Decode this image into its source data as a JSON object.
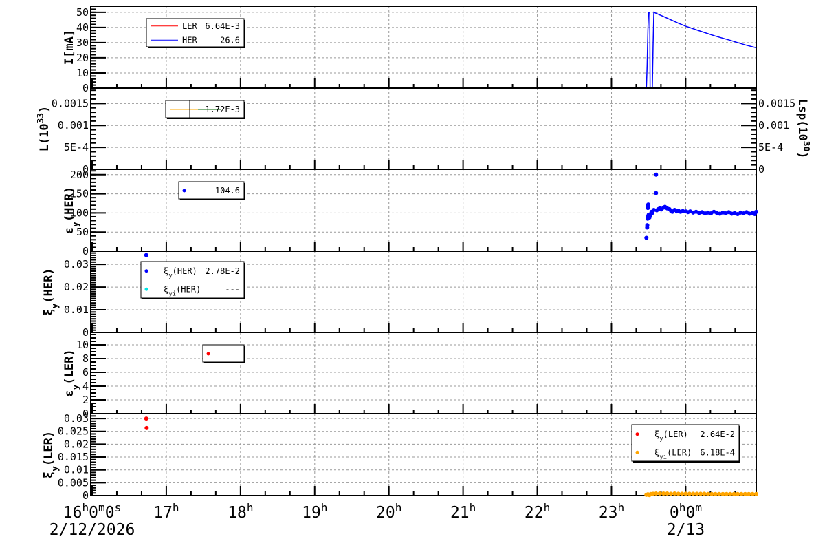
{
  "chart_data": [
    {
      "type": "line",
      "panel": "current",
      "ylabel": {
        "main": "I[mA]"
      },
      "ylim": [
        0,
        54
      ],
      "yticks": [
        {
          "v": 0,
          "t": "0"
        },
        {
          "v": 10,
          "t": "10"
        },
        {
          "v": 20,
          "t": "20"
        },
        {
          "v": 30,
          "t": "30"
        },
        {
          "v": 40,
          "t": "40"
        },
        {
          "v": 50,
          "t": "50"
        }
      ],
      "yminor_step": 2,
      "series": [
        {
          "name": "HER",
          "color": "#0000ff",
          "points": [
            [
              16,
              0
            ],
            [
              23.47,
              0
            ],
            [
              23.48,
              15
            ],
            [
              23.49,
              38
            ],
            [
              23.5,
              50
            ],
            [
              23.515,
              50
            ],
            [
              23.52,
              0
            ],
            [
              23.55,
              0
            ],
            [
              23.56,
              28
            ],
            [
              23.57,
              50
            ],
            [
              23.6,
              49.3
            ],
            [
              23.7,
              47.2
            ],
            [
              23.8,
              45
            ],
            [
              23.9,
              42.8
            ],
            [
              24,
              40.8
            ],
            [
              24.2,
              37.5
            ],
            [
              24.4,
              34.3
            ],
            [
              24.6,
              31.5
            ],
            [
              24.8,
              28.5
            ],
            [
              24.95,
              26.6
            ]
          ]
        },
        {
          "name": "LER",
          "color": "#ff0000",
          "points": [
            [
              23.3,
              0
            ],
            [
              24.95,
              0
            ]
          ]
        }
      ],
      "legend": [
        {
          "label": "LER",
          "value": "6.64E-3",
          "color": "#ff0000",
          "marker": "line"
        },
        {
          "label": "HER",
          "value": "26.6",
          "color": "#0000ff",
          "marker": "line"
        }
      ]
    },
    {
      "type": "line",
      "panel": "luminosity",
      "ylabel": {
        "main": "L(10",
        "sup": "33",
        "end": ")"
      },
      "ylabel_right": {
        "main": "Lsp(10",
        "sup": "30",
        "end": ")"
      },
      "ylim": [
        0,
        0.00185
      ],
      "yticks": [
        {
          "v": 0,
          "t": "0"
        },
        {
          "v": 0.0005,
          "t": "5E-4"
        },
        {
          "v": 0.001,
          "t": "0.001"
        },
        {
          "v": 0.0015,
          "t": "0.0015"
        }
      ],
      "yminor_step": 0.0001,
      "series": [],
      "legend": [
        {
          "label": "",
          "value": "1.72E-3",
          "color": "#ffaa00",
          "color2": "#006600",
          "marker": "line2"
        }
      ]
    },
    {
      "type": "scatter",
      "panel": "emittance-her",
      "ylabel": {
        "main": "ε",
        "sub": "y",
        "end": "(HER)"
      },
      "ylim": [
        0,
        214
      ],
      "yticks": [
        {
          "v": 0,
          "t": "0"
        },
        {
          "v": 50,
          "t": "50"
        },
        {
          "v": 100,
          "t": "100"
        },
        {
          "v": 150,
          "t": "150"
        },
        {
          "v": 200,
          "t": "200"
        }
      ],
      "yminor_step": 10,
      "series": [
        {
          "name": "εy(HER)",
          "color": "#0000ff",
          "points": [
            [
              23.47,
              35
            ],
            [
              23.48,
              62
            ],
            [
              23.482,
              68
            ],
            [
              23.487,
              85
            ],
            [
              23.49,
              90
            ],
            [
              23.49,
              113
            ],
            [
              23.492,
              118
            ],
            [
              23.495,
              122
            ],
            [
              23.5,
              95
            ],
            [
              23.51,
              88
            ],
            [
              23.52,
              92
            ],
            [
              23.53,
              98
            ],
            [
              23.54,
              103
            ],
            [
              23.55,
              100
            ],
            [
              23.57,
              108
            ],
            [
              23.6,
              200
            ],
            [
              23.6,
              152
            ],
            [
              23.61,
              107
            ],
            [
              23.63,
              110
            ],
            [
              23.65,
              112
            ],
            [
              23.67,
              109
            ],
            [
              23.7,
              114
            ],
            [
              23.72,
              116
            ],
            [
              23.75,
              112
            ],
            [
              23.78,
              110
            ],
            [
              23.8,
              106
            ],
            [
              23.82,
              103
            ],
            [
              23.85,
              108
            ],
            [
              23.88,
              104
            ],
            [
              23.9,
              106
            ],
            [
              23.93,
              103
            ],
            [
              23.96,
              105
            ],
            [
              24,
              104
            ],
            [
              24.03,
              102
            ],
            [
              24.06,
              104
            ],
            [
              24.1,
              101
            ],
            [
              24.14,
              103
            ],
            [
              24.18,
              100
            ],
            [
              24.22,
              102
            ],
            [
              24.26,
              99
            ],
            [
              24.3,
              101
            ],
            [
              24.34,
              99
            ],
            [
              24.38,
              103
            ],
            [
              24.42,
              100
            ],
            [
              24.46,
              98
            ],
            [
              24.5,
              101
            ],
            [
              24.54,
              99
            ],
            [
              24.58,
              102
            ],
            [
              24.62,
              98
            ],
            [
              24.66,
              100
            ],
            [
              24.7,
              97
            ],
            [
              24.74,
              101
            ],
            [
              24.78,
              99
            ],
            [
              24.82,
              102
            ],
            [
              24.86,
              98
            ],
            [
              24.9,
              100
            ],
            [
              24.93,
              97
            ],
            [
              24.95,
              103
            ]
          ]
        }
      ],
      "legend": [
        {
          "label": "",
          "value": "104.6",
          "color": "#0000ff",
          "marker": "dot"
        }
      ]
    },
    {
      "type": "scatter",
      "panel": "tuneshift-her",
      "ylabel": {
        "main": "ξ",
        "sub": "y",
        "end": "(HER)"
      },
      "ylim": [
        0,
        0.0358
      ],
      "yticks": [
        {
          "v": 0,
          "t": "0"
        },
        {
          "v": 0.01,
          "t": "0.01"
        },
        {
          "v": 0.02,
          "t": "0.02"
        },
        {
          "v": 0.03,
          "t": "0.03"
        }
      ],
      "yminor_step": 0.001,
      "series": [
        {
          "name": "ξy(HER)",
          "color": "#0000ff",
          "points": [
            [
              16.73,
              0.0341
            ],
            [
              16.73,
              0.028
            ],
            [
              16.735,
              0.0273
            ]
          ]
        },
        {
          "name": "ξyi(HER)",
          "color": "#00e5e5",
          "points": []
        }
      ],
      "legend": [
        {
          "label": {
            "main": "ξ",
            "sub": "y",
            "end": "(HER)"
          },
          "value": "2.78E-2",
          "color": "#0000ff",
          "marker": "dot"
        },
        {
          "label": {
            "main": "ξ",
            "sub": "yi",
            "end": "(HER)"
          },
          "value": "---",
          "color": "#00e5e5",
          "marker": "dot"
        }
      ]
    },
    {
      "type": "scatter",
      "panel": "emittance-ler",
      "ylabel": {
        "main": "ε",
        "sub": "y",
        "end": "(LER)"
      },
      "ylim": [
        0,
        11.8
      ],
      "yticks": [
        {
          "v": 0,
          "t": "0"
        },
        {
          "v": 2,
          "t": "2"
        },
        {
          "v": 4,
          "t": "4"
        },
        {
          "v": 6,
          "t": "6"
        },
        {
          "v": 8,
          "t": "8"
        },
        {
          "v": 10,
          "t": "10"
        }
      ],
      "yminor_step": 0.5,
      "series": [
        {
          "name": "εy(LER)",
          "color": "#ff0000",
          "points": []
        }
      ],
      "legend": [
        {
          "label": "",
          "value": "---",
          "color": "#ff0000",
          "marker": "dot"
        }
      ]
    },
    {
      "type": "scatter",
      "panel": "tuneshift-ler",
      "ylabel": {
        "main": "ξ",
        "sub": "y",
        "end": "(LER)"
      },
      "ylim": [
        0,
        0.0319
      ],
      "yticks": [
        {
          "v": 0,
          "t": "0"
        },
        {
          "v": 0.005,
          "t": "0.005"
        },
        {
          "v": 0.01,
          "t": "0.01"
        },
        {
          "v": 0.015,
          "t": "0.015"
        },
        {
          "v": 0.02,
          "t": "0.02"
        },
        {
          "v": 0.025,
          "t": "0.025"
        },
        {
          "v": 0.03,
          "t": "0.03"
        }
      ],
      "yminor_step": 0.001,
      "series": [
        {
          "name": "ξy(LER)",
          "color": "#ff0000",
          "points": [
            [
              16.73,
              0.03
            ],
            [
              16.735,
              0.0263
            ]
          ]
        },
        {
          "name": "ξyi(LER)",
          "color": "#ffa500",
          "points": [
            [
              23.47,
              0.0003
            ],
            [
              23.49,
              0.0005
            ],
            [
              23.51,
              0.0002
            ],
            [
              23.53,
              0.0006
            ],
            [
              23.56,
              0.0007
            ],
            [
              23.6,
              0.0008
            ],
            [
              23.65,
              0.0008
            ],
            [
              23.7,
              0.0008
            ],
            [
              23.75,
              0.0008
            ],
            [
              23.8,
              0.0007
            ],
            [
              23.85,
              0.0008
            ],
            [
              23.9,
              0.0007
            ],
            [
              23.95,
              0.0007
            ],
            [
              24,
              0.0007
            ],
            [
              24.05,
              0.0007
            ],
            [
              24.1,
              0.0007
            ],
            [
              24.15,
              0.0007
            ],
            [
              24.2,
              0.0007
            ],
            [
              24.25,
              0.0007
            ],
            [
              24.3,
              0.0006
            ],
            [
              24.35,
              0.0006
            ],
            [
              24.4,
              0.0006
            ],
            [
              24.45,
              0.0006
            ],
            [
              24.5,
              0.0006
            ],
            [
              24.55,
              0.0006
            ],
            [
              24.6,
              0.0006
            ],
            [
              24.65,
              0.0006
            ],
            [
              24.7,
              0.0006
            ],
            [
              24.75,
              0.0006
            ],
            [
              24.8,
              0.0006
            ],
            [
              24.85,
              0.0006
            ],
            [
              24.9,
              0.0006
            ],
            [
              24.95,
              0.0006
            ]
          ]
        }
      ],
      "legend": [
        {
          "label": {
            "main": "ξ",
            "sub": "y",
            "end": "(LER)"
          },
          "value": "2.64E-2",
          "color": "#ff0000",
          "marker": "dot"
        },
        {
          "label": {
            "main": "ξ",
            "sub": "yi",
            "end": "(LER)"
          },
          "value": "6.18E-4",
          "color": "#ffa500",
          "marker": "dot"
        }
      ]
    }
  ],
  "x_axis": {
    "range_hours": [
      16,
      24.95
    ],
    "minor_step_hours": 0.3333,
    "major_ticks": [
      {
        "h": 16,
        "parts": [
          [
            "16",
            "h"
          ],
          [
            "0",
            "m"
          ],
          [
            "0",
            "s"
          ]
        ]
      },
      {
        "h": 17,
        "parts": [
          [
            "17",
            "h"
          ]
        ]
      },
      {
        "h": 18,
        "parts": [
          [
            "18",
            "h"
          ]
        ]
      },
      {
        "h": 19,
        "parts": [
          [
            "19",
            "h"
          ]
        ]
      },
      {
        "h": 20,
        "parts": [
          [
            "20",
            "h"
          ]
        ]
      },
      {
        "h": 21,
        "parts": [
          [
            "21",
            "h"
          ]
        ]
      },
      {
        "h": 22,
        "parts": [
          [
            "22",
            "h"
          ]
        ]
      },
      {
        "h": 23,
        "parts": [
          [
            "23",
            "h"
          ]
        ]
      },
      {
        "h": 24,
        "parts": [
          [
            "0",
            "h"
          ],
          [
            "0",
            "m"
          ]
        ]
      }
    ],
    "dates": [
      {
        "h": 16,
        "text": "2/12/2026"
      },
      {
        "h": 24,
        "text": "2/13"
      }
    ]
  }
}
